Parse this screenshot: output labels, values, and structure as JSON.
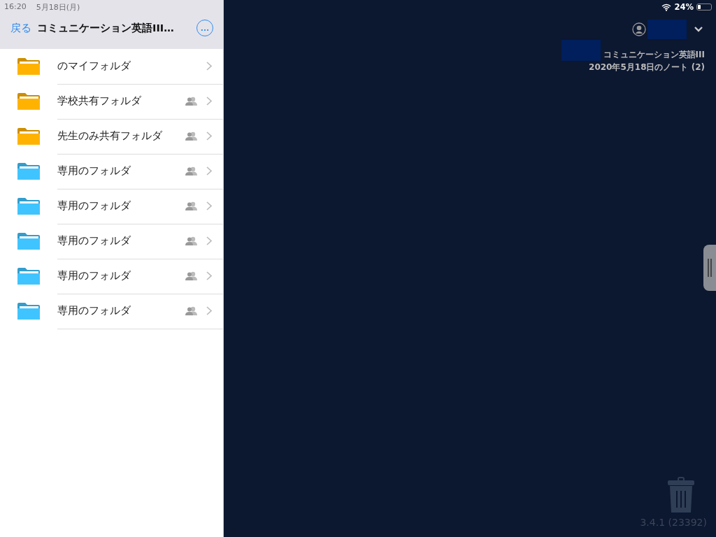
{
  "status_bar": {
    "time": "16:20",
    "date": "5月18日(月)",
    "battery_text": "24%",
    "battery": {
      "level": 0.24
    }
  },
  "sidebar": {
    "back": "戻る",
    "title": "コミュニケーション英語III…",
    "more": "…",
    "folders": [
      {
        "name": "のマイフォルダ",
        "color": "#ffb300",
        "shared": false
      },
      {
        "name": "学校共有フォルダ",
        "color": "#ffb300",
        "shared": true
      },
      {
        "name": "先生のみ共有フォルダ",
        "color": "#ffb300",
        "shared": true
      },
      {
        "name": "専用のフォルダ",
        "color": "#40c4ff",
        "shared": true
      },
      {
        "name": "専用のフォルダ",
        "color": "#40c4ff",
        "shared": true
      },
      {
        "name": "専用のフォルダ",
        "color": "#40c4ff",
        "shared": true
      },
      {
        "name": "専用のフォルダ",
        "color": "#40c4ff",
        "shared": true
      },
      {
        "name": "専用のフォルダ",
        "color": "#40c4ff",
        "shared": true
      }
    ]
  },
  "main": {
    "course": "コミュニケーション英語III",
    "note": "2020年5月18日のノート (2)",
    "version": "3.4.1 (23392)"
  }
}
